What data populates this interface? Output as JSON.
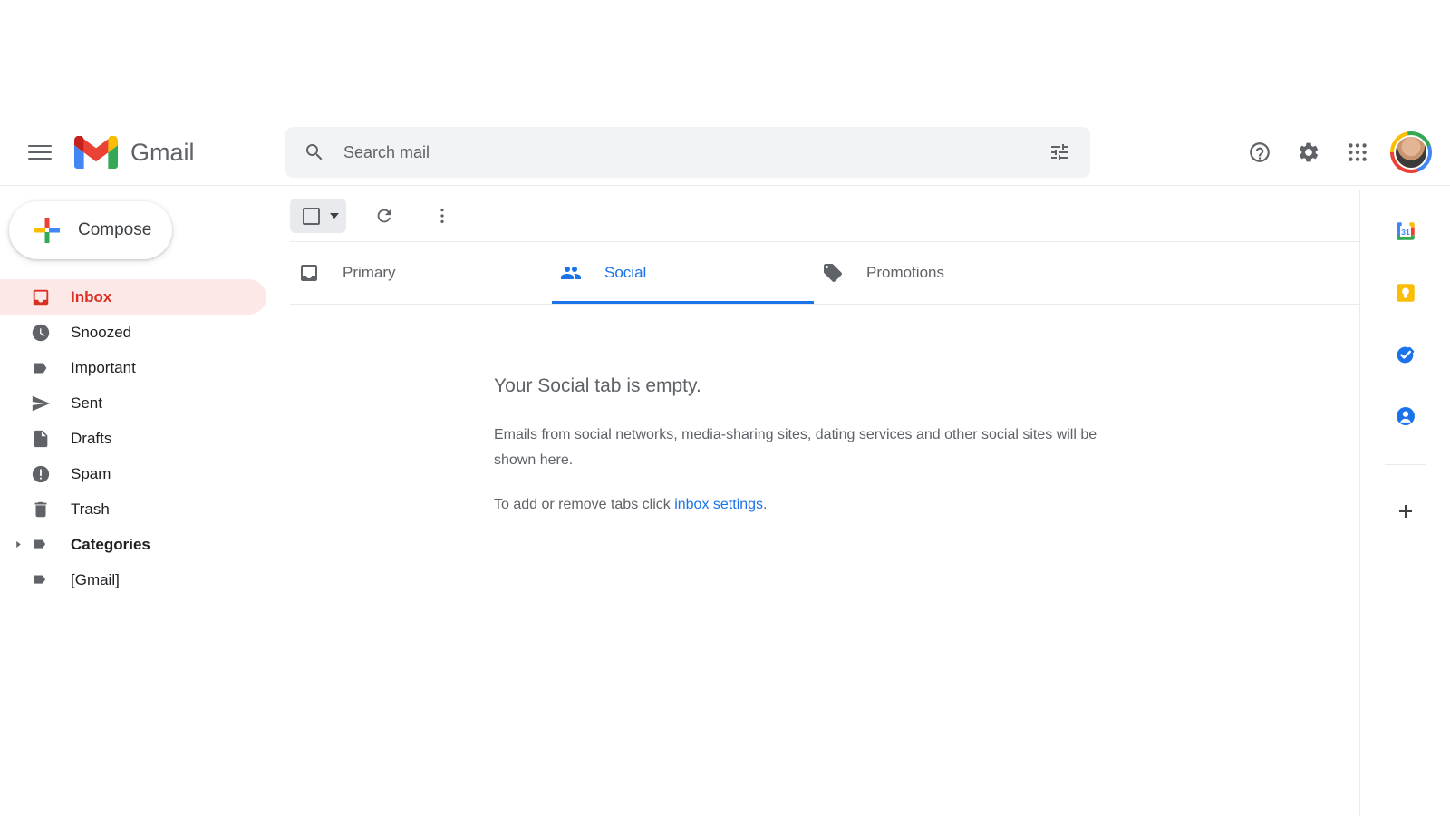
{
  "header": {
    "menu_icon": "hamburger-menu-icon",
    "logo_icon": "gmail-logo-icon",
    "brand": "Gmail",
    "search": {
      "icon": "search-icon",
      "placeholder": "Search mail",
      "value": "",
      "filter_icon": "tune-filter-icon"
    },
    "actions": [
      {
        "name": "help-icon",
        "label": "Support"
      },
      {
        "name": "gear-icon",
        "label": "Settings"
      },
      {
        "name": "apps-grid-icon",
        "label": "Google apps"
      },
      {
        "name": "avatar",
        "label": "Google Account"
      }
    ]
  },
  "sidebar": {
    "compose": {
      "label": "Compose",
      "icon": "plus-icon"
    },
    "items": [
      {
        "label": "Inbox",
        "icon": "inbox-icon",
        "active": true,
        "bold": true,
        "expandable": false
      },
      {
        "label": "Snoozed",
        "icon": "clock-icon",
        "active": false,
        "bold": false,
        "expandable": false
      },
      {
        "label": "Important",
        "icon": "label-important-icon",
        "active": false,
        "bold": false,
        "expandable": false
      },
      {
        "label": "Sent",
        "icon": "send-icon",
        "active": false,
        "bold": false,
        "expandable": false
      },
      {
        "label": "Drafts",
        "icon": "draft-icon",
        "active": false,
        "bold": false,
        "expandable": false
      },
      {
        "label": "Spam",
        "icon": "spam-icon",
        "active": false,
        "bold": false,
        "expandable": false
      },
      {
        "label": "Trash",
        "icon": "trash-icon",
        "active": false,
        "bold": false,
        "expandable": false
      },
      {
        "label": "Categories",
        "icon": "label-icon",
        "active": false,
        "bold": true,
        "expandable": true
      },
      {
        "label": "[Gmail]",
        "icon": "label-icon",
        "active": false,
        "bold": false,
        "expandable": false
      }
    ]
  },
  "toolbar": {
    "select_all": {
      "name": "select-all-checkbox",
      "checked": false,
      "dropdown_icon": "chevron-down-icon"
    },
    "refresh": {
      "name": "refresh-icon",
      "label": "Refresh"
    },
    "more": {
      "name": "more-options-icon",
      "label": "More"
    }
  },
  "tabs": [
    {
      "label": "Primary",
      "icon": "inbox-tab-icon",
      "active": false
    },
    {
      "label": "Social",
      "icon": "people-icon",
      "active": true
    },
    {
      "label": "Promotions",
      "icon": "tag-icon",
      "active": false
    }
  ],
  "empty_state": {
    "title": "Your Social tab is empty.",
    "body": "Emails from social networks, media-sharing sites, dating services and other social sites will be shown here.",
    "footer_prefix": "To add or remove tabs click ",
    "footer_link": "inbox settings",
    "footer_suffix": "."
  },
  "right_panel": {
    "items": [
      {
        "name": "google-calendar-icon",
        "label": "Calendar",
        "badge": "31"
      },
      {
        "name": "google-keep-icon",
        "label": "Keep",
        "badge": ""
      },
      {
        "name": "google-tasks-icon",
        "label": "Tasks",
        "badge": ""
      },
      {
        "name": "google-contacts-icon",
        "label": "Contacts",
        "badge": ""
      }
    ],
    "add": {
      "name": "add-icon",
      "label": "Get Add-ons"
    }
  },
  "colors": {
    "brand_red": "#d93025",
    "accent_blue": "#1a73e8",
    "active_bg": "#fce8e6",
    "text_secondary": "#5f6368",
    "divider": "#e8eaed"
  }
}
